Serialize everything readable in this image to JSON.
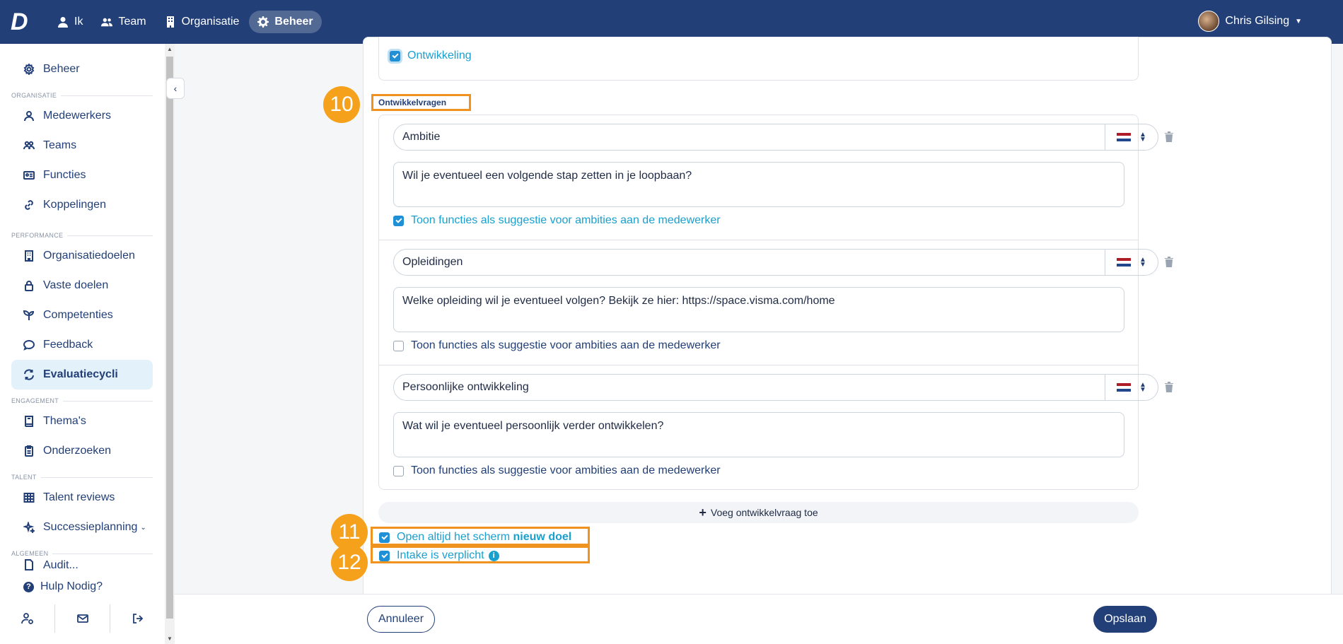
{
  "topnav": {
    "logo": "D",
    "items": [
      {
        "label": "Ik",
        "icon": "user-icon"
      },
      {
        "label": "Team",
        "icon": "users-icon"
      },
      {
        "label": "Organisatie",
        "icon": "building-icon"
      },
      {
        "label": "Beheer",
        "icon": "gear-icon",
        "active": true
      }
    ],
    "user_name": "Chris Gilsing"
  },
  "sidebar": {
    "top_item": "Beheer",
    "sections": [
      {
        "title": "ORGANISATIE",
        "items": [
          "Medewerkers",
          "Teams",
          "Functies",
          "Koppelingen"
        ]
      },
      {
        "title": "PERFORMANCE",
        "items": [
          "Organisatiedoelen",
          "Vaste doelen",
          "Competenties",
          "Feedback",
          "Evaluatiecycli"
        ]
      },
      {
        "title": "ENGAGEMENT",
        "items": [
          "Thema's",
          "Onderzoeken"
        ]
      },
      {
        "title": "TALENT",
        "items": [
          "Talent reviews",
          "Successieplanning"
        ]
      },
      {
        "title": "ALGEMEEN",
        "items": [
          "Audit..."
        ]
      }
    ],
    "active_item": "Evaluatiecycli",
    "help": "Hulp Nodig?"
  },
  "main": {
    "top_checkbox": {
      "label": "Ontwikkeling",
      "checked": true
    },
    "section_label": "Ontwikkelvragen",
    "badges": [
      "10",
      "11",
      "12"
    ],
    "questions": [
      {
        "title": "Ambitie",
        "text": "Wil je eventueel een volgende stap zetten in je loopbaan?",
        "suggest_label": "Toon functies als suggestie voor ambities aan de medewerker",
        "suggest_checked": true
      },
      {
        "title": "Opleidingen",
        "text": "Welke opleiding wil je eventueel volgen? Bekijk ze hier: https://space.visma.com/home",
        "suggest_label": "Toon functies als suggestie voor ambities aan de medewerker",
        "suggest_checked": false
      },
      {
        "title": "Persoonlijke ontwikkeling",
        "text": "Wat wil je eventueel persoonlijk verder ontwikkelen?",
        "suggest_label": "Toon functies als suggestie voor ambities aan de medewerker",
        "suggest_checked": false
      }
    ],
    "add_button": "Voeg ontwikkelvraag toe",
    "open_screen": {
      "prefix": "Open altijd het scherm",
      "bold": "nieuw doel",
      "checked": true
    },
    "intake": {
      "label": "Intake is verplicht",
      "checked": true
    }
  },
  "footer": {
    "cancel": "Annuleer",
    "save": "Opslaan"
  },
  "colors": {
    "navy": "#223f77",
    "accent": "#1aa0cf",
    "highlight": "#f0931e",
    "badge": "#f5a11c"
  }
}
